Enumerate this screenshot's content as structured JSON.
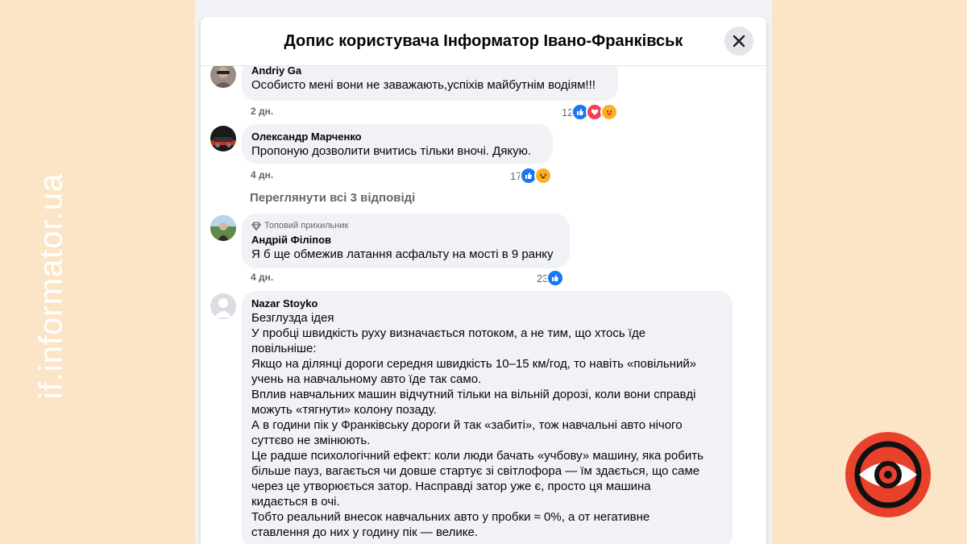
{
  "brand": {
    "vertical_text": "if.informator.ua",
    "colors": {
      "accent": "#E8412C",
      "background": "#FCE5C6"
    }
  },
  "modal": {
    "title": "Допис користувача Інформатор Івано-Франківськ",
    "close_icon": "close-icon"
  },
  "comments": [
    {
      "author": "Andriy Ga",
      "text": "Особисто мені вони не заважають,успіхів майбутнім водіям!!!",
      "time": "2 дн.",
      "reaction_count": "12",
      "reactions": [
        "like",
        "love",
        "care"
      ]
    },
    {
      "author": "Олександр Марченко",
      "text": "Пропоную дозволити вчитись тільки вночі. Дякую.",
      "time": "4 дн.",
      "reaction_count": "17",
      "reactions": [
        "like",
        "haha"
      ]
    },
    {
      "view_replies": "Переглянути всі 3 відповіді"
    },
    {
      "badge": "Топовий прихильник",
      "author": "Андрій Філіпов",
      "text": "Я б ще обмежив латання асфальту на мості в 9 ранку",
      "time": "4 дн.",
      "reaction_count": "23",
      "reactions": [
        "like"
      ]
    },
    {
      "author": "Nazar Stoyko",
      "lines": [
        "Безглузда ідея",
        "У пробці швидкість руху визначається потоком, а не тим, що хтось їде",
        "повільніше:",
        "Якщо на ділянці дороги середня швидкість 10–15 км/год, то навіть «повільний»",
        "учень на навчальному авто їде так само.",
        "Вплив навчальних машин відчутний тільки на вільній дорозі, коли вони справді",
        "можуть «тягнути» колону позаду.",
        "А в години пік у Франківську дороги й так «забиті», тож навчальні авто нічого",
        "суттєво не змінюють.",
        "Це радше психологічний ефект: коли люди бачать «учбову» машину, яка робить",
        "більше пауз, вагається чи довше стартує зі світлофора — їм здається, що саме",
        "через це утворюється затор. Насправді затор уже є, просто ця машина",
        "кидається в очі.",
        "Тобто реальний внесок навчальних авто у пробки ≈ 0%, а от негативне",
        "ставлення до них у годину пік — велике."
      ]
    }
  ]
}
